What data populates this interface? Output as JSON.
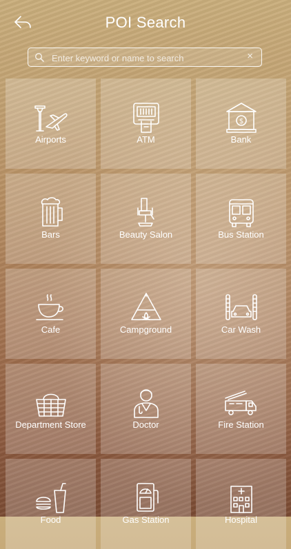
{
  "header": {
    "title": "POI Search",
    "back_icon": "back-arrow-icon"
  },
  "search": {
    "placeholder": "Enter keyword or name to search",
    "value": "",
    "clear_label": "×"
  },
  "categories": [
    {
      "label": "Airports",
      "icon": "airport-icon"
    },
    {
      "label": "ATM",
      "icon": "atm-icon"
    },
    {
      "label": "Bank",
      "icon": "bank-icon"
    },
    {
      "label": "Bars",
      "icon": "beer-mug-icon"
    },
    {
      "label": "Beauty Salon",
      "icon": "salon-chair-icon"
    },
    {
      "label": "Bus Station",
      "icon": "bus-icon"
    },
    {
      "label": "Cafe",
      "icon": "coffee-cup-icon"
    },
    {
      "label": "Campground",
      "icon": "tent-icon"
    },
    {
      "label": "Car Wash",
      "icon": "car-wash-icon"
    },
    {
      "label": "Department Store",
      "icon": "basket-icon"
    },
    {
      "label": "Doctor",
      "icon": "doctor-icon"
    },
    {
      "label": "Fire Station",
      "icon": "fire-truck-icon"
    },
    {
      "label": "Food",
      "icon": "food-icon"
    },
    {
      "label": "Gas Station",
      "icon": "gas-pump-icon"
    },
    {
      "label": "Hospital",
      "icon": "hospital-icon"
    }
  ]
}
